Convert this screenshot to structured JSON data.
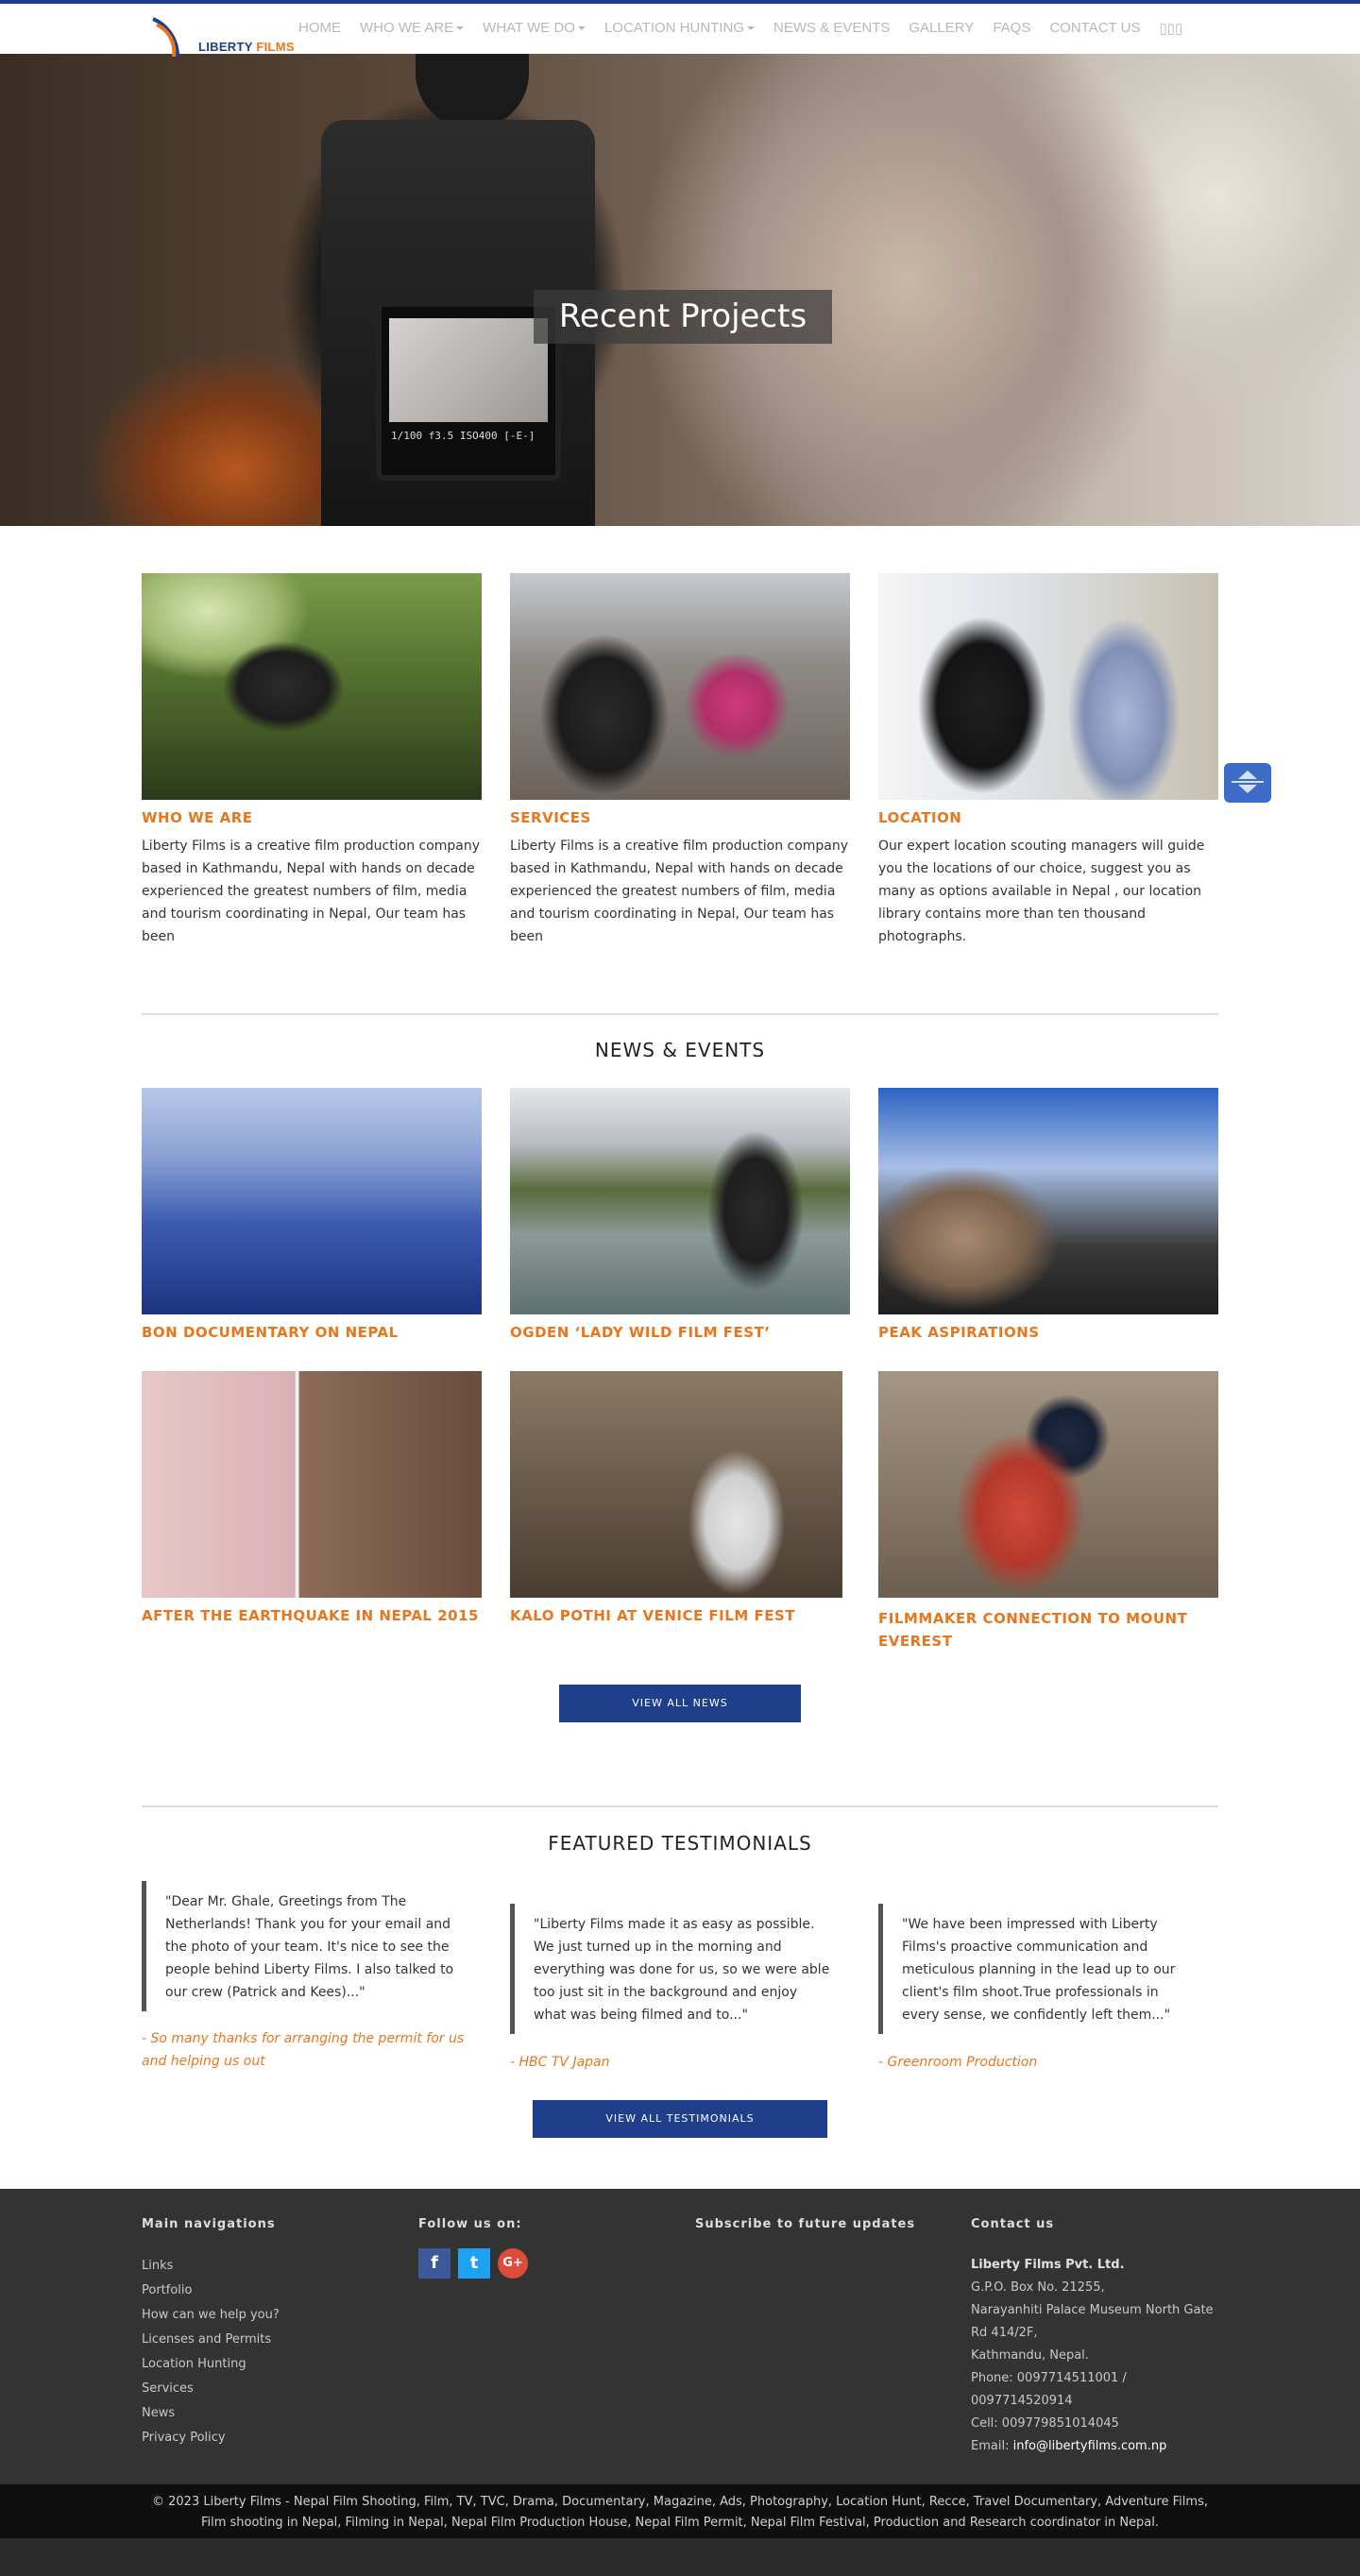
{
  "brand": {
    "name_part1": "LIBERTY",
    "name_part2": "FILMS"
  },
  "nav": {
    "items": [
      {
        "label": "HOME",
        "dropdown": false
      },
      {
        "label": "WHO WE ARE",
        "dropdown": true
      },
      {
        "label": "WHAT WE DO",
        "dropdown": true
      },
      {
        "label": "LOCATION HUNTING",
        "dropdown": true
      },
      {
        "label": "NEWS & EVENTS",
        "dropdown": false
      },
      {
        "label": "GALLERY",
        "dropdown": false
      },
      {
        "label": "FAQS",
        "dropdown": false
      },
      {
        "label": "CONTACT US",
        "dropdown": false
      },
      {
        "label": "▯▯▯",
        "dropdown": false
      }
    ]
  },
  "hero": {
    "title": "Recent Projects",
    "readout": "1/100  f3.5  ISO400  [-E-]"
  },
  "about": {
    "cards": [
      {
        "title": "WHO WE ARE",
        "text": "Liberty Films is a creative film production company based in Kathmandu, Nepal with hands on decade experienced the greatest numbers of film, media and tourism coordinating in Nepal, Our team has been"
      },
      {
        "title": "SERVICES",
        "text": "Liberty Films is a creative film production company based in Kathmandu, Nepal with hands on decade experienced the greatest numbers of film, media and tourism coordinating in Nepal, Our team has been"
      },
      {
        "title": "LOCATION",
        "text": "Our expert location scouting managers will guide you the locations of our choice, suggest you as many as options available in Nepal , our location library contains more than ten thousand photographs."
      }
    ]
  },
  "news": {
    "heading": "NEWS & EVENTS",
    "items": [
      {
        "title": "BON DOCUMENTARY ON NEPAL"
      },
      {
        "title": "OGDEN ‘LADY WILD FILM FEST’"
      },
      {
        "title": "PEAK ASPIRATIONS"
      },
      {
        "title": "AFTER THE EARTHQUAKE IN NEPAL 2015"
      },
      {
        "title": "KALO POTHI AT VENICE FILM FEST"
      },
      {
        "title": "FILMMAKER CONNECTION TO MOUNT EVEREST"
      }
    ],
    "button": "VIEW ALL NEWS"
  },
  "testimonials": {
    "heading": "FEATURED TESTIMONIALS",
    "items": [
      {
        "quote": "\"Dear Mr. Ghale, Greetings from The Netherlands! Thank you for your email and the photo of your team. It's nice to see the people behind Liberty Films. I also talked to our crew (Patrick and Kees)...\"",
        "author": "- So many thanks for arranging the permit for us and helping us out"
      },
      {
        "quote": "\"Liberty Films made it as easy as possible. We just turned up in the morning and everything was done for us, so we were able too just sit in the background and enjoy what was being filmed and to...\"",
        "author": "- HBC TV Japan"
      },
      {
        "quote": "\"We have been impressed with Liberty Films's proactive communication and meticulous planning in the lead up to our client's film shoot.True professionals in every sense, we confidently left them...\"",
        "author": "- Greenroom Production"
      }
    ],
    "button": "VIEW ALL TESTIMONIALS"
  },
  "footer": {
    "nav_heading": "Main navigations",
    "nav_links": [
      "Links",
      "Portfolio",
      "How can we help you?",
      "Licenses and Permits",
      "Location Hunting",
      "Services",
      "News",
      "Privacy Policy"
    ],
    "follow_heading": "Follow us on:",
    "social": {
      "facebook": "f",
      "twitter": "t",
      "google": "G+"
    },
    "subscribe_heading": "Subscribe to future updates",
    "contact_heading": "Contact us",
    "contact": {
      "company": "Liberty Films Pvt. Ltd.",
      "box": "G.P.O. Box No. 21255,",
      "address1": "Narayanhiti Palace Museum North Gate Rd 414/2F,",
      "address2": "Kathmandu, Nepal.",
      "phone": "Phone: 0097714511001 / 0097714520914",
      "cell": "Cell: 009779851014045",
      "email_label": "Email: ",
      "email": "info@libertyfilms.com.np"
    }
  },
  "copyright": {
    "line1": "© 2023 Liberty Films - Nepal Film Shooting, Film, TV, TVC, Drama, Documentary, Magazine, Ads, Photography, Location Hunt, Recce, Travel Documentary, Adventure Films,",
    "line2": "Film shooting in Nepal, Filming in Nepal, Nepal Film Production House, Nepal Film Permit, Nepal Film Festival, Production and Research coordinator in Nepal."
  },
  "colors": {
    "accent_orange": "#e8761e",
    "brand_blue": "#1f3e8c",
    "footer_bg": "#333333"
  }
}
